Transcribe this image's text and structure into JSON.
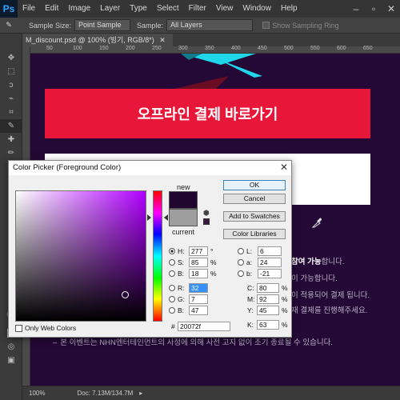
{
  "app": {
    "logo": "Ps"
  },
  "menu": [
    "File",
    "Edit",
    "Image",
    "Layer",
    "Type",
    "Select",
    "Filter",
    "View",
    "Window",
    "Help"
  ],
  "options_bar": {
    "sample_size_label": "Sample Size:",
    "sample_size_value": "Point Sample",
    "sample_label": "Sample:",
    "sample_value": "All Layers",
    "show_ring_label": "Show Sampling Ring"
  },
  "document": {
    "tab_title": "M_discount.psd @ 100% (빙기, RGB/8*)",
    "ruler_ticks": [
      "50",
      "100",
      "150",
      "200",
      "250",
      "300",
      "350",
      "400",
      "450",
      "500",
      "550",
      "600",
      "650"
    ]
  },
  "canvas": {
    "red_banner_text": "오프라인 결제 바로가기",
    "notes": [
      {
        "text": "참여 가능",
        "suffix": "합니다."
      },
      {
        "text": "",
        "suffix": "이 가능합니다."
      },
      {
        "text": "",
        "suffix": "이 적용되어 결제 됩니다."
      },
      {
        "text": "",
        "suffix": "재 결제를 진행해주세요."
      },
      {
        "text": "",
        "suffix": "본 이벤트는 NHN엔터테인먼트의 사정에 의해 사전 고지 없이 조기 종료될 수 있습니다."
      }
    ]
  },
  "status_bar": {
    "zoom": "100%",
    "doc": "Doc: 7.13M/134.7M"
  },
  "color_picker": {
    "title": "Color Picker (Foreground Color)",
    "new_label": "new",
    "current_label": "current",
    "new_color": "#20072f",
    "current_color": "#9e9e9e",
    "buttons": {
      "ok": "OK",
      "cancel": "Cancel",
      "add_swatches": "Add to Swatches",
      "color_libraries": "Color Libraries"
    },
    "hsb": [
      {
        "label": "H:",
        "value": "277",
        "unit": "°"
      },
      {
        "label": "S:",
        "value": "85",
        "unit": "%"
      },
      {
        "label": "B:",
        "value": "18",
        "unit": "%"
      }
    ],
    "rgb": [
      {
        "label": "R:",
        "value": "32"
      },
      {
        "label": "G:",
        "value": "7"
      },
      {
        "label": "B:",
        "value": "47"
      }
    ],
    "lab": [
      {
        "label": "L:",
        "value": "6"
      },
      {
        "label": "a:",
        "value": "24"
      },
      {
        "label": "b:",
        "value": "-21"
      }
    ],
    "cmyk": [
      {
        "label": "C:",
        "value": "80",
        "unit": "%"
      },
      {
        "label": "M:",
        "value": "92",
        "unit": "%"
      },
      {
        "label": "Y:",
        "value": "45",
        "unit": "%"
      },
      {
        "label": "K:",
        "value": "63",
        "unit": "%"
      }
    ],
    "hex_label": "#",
    "hex_value": "20072f",
    "only_web_colors": "Only Web Colors"
  }
}
